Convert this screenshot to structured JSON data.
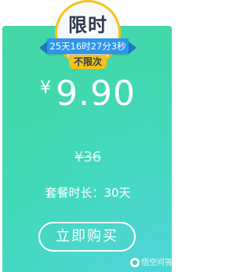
{
  "badge": {
    "limited_label": "限时",
    "countdown": "25天16时27分3秒",
    "unlimited_label": "不限次"
  },
  "pricing": {
    "currency": "¥",
    "price": "9.90",
    "original_price": "¥36",
    "duration": "套餐时长：30天"
  },
  "actions": {
    "buy_label": "立即购买"
  },
  "watermark": {
    "text": "悟空问答"
  },
  "colors": {
    "card_gradient_start": "#44d6a5",
    "card_gradient_end": "#4ad7d0",
    "ribbon": "#2f95e8",
    "tab": "#f6c21a"
  }
}
